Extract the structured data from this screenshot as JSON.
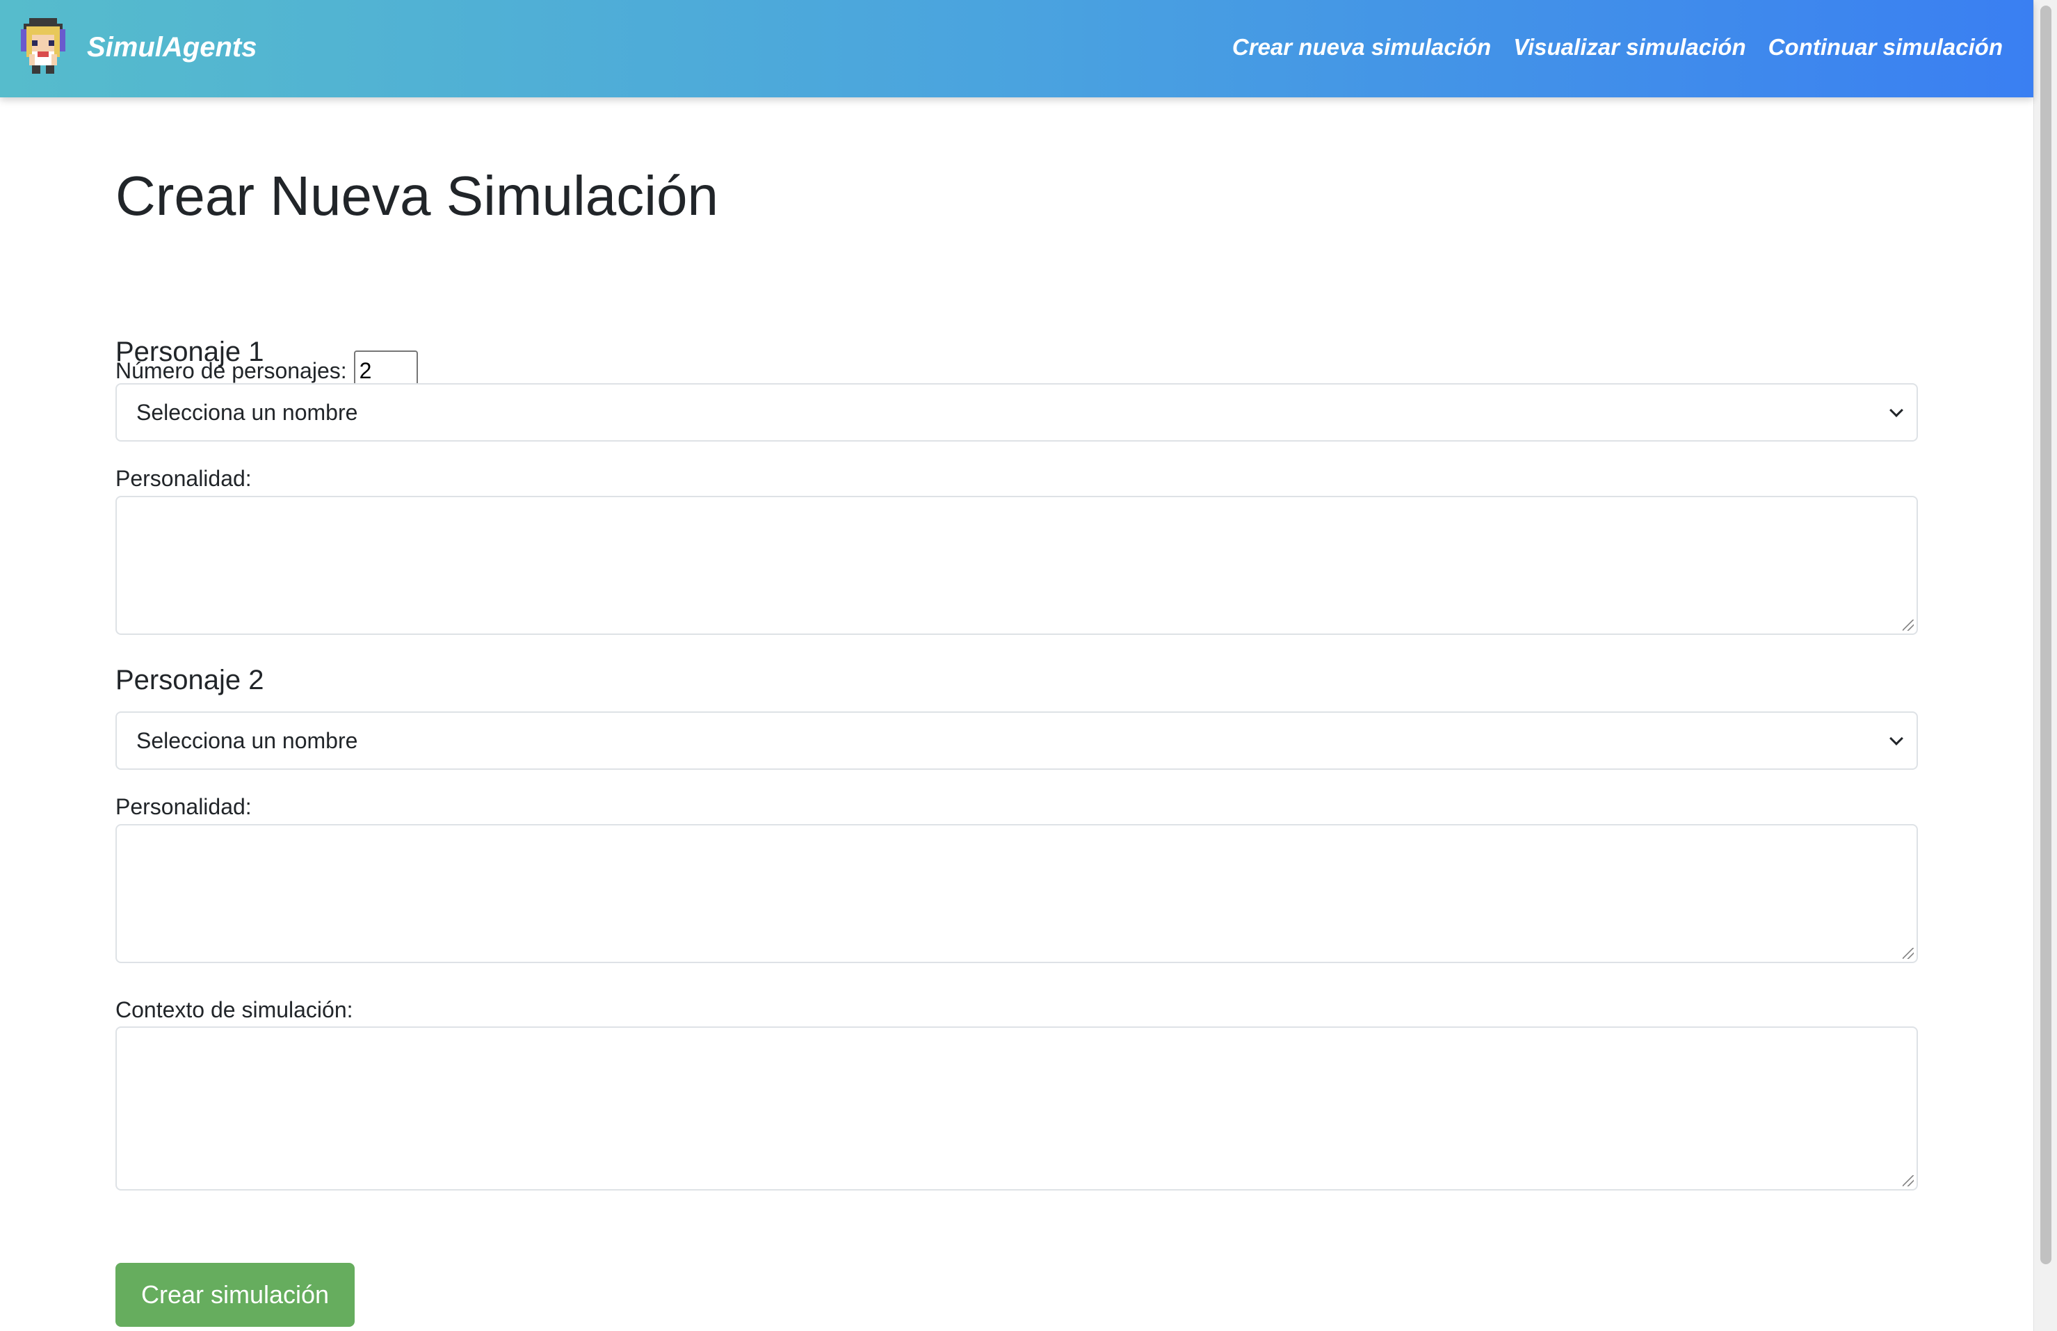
{
  "navbar": {
    "brand": "SimulAgents",
    "links": [
      "Crear nueva simulación",
      "Visualizar simulación",
      "Continuar simulación"
    ]
  },
  "main": {
    "title": "Crear Nueva Simulación",
    "count_label": "Número de personajes:",
    "count_value": "2",
    "characters": [
      {
        "heading": "Personaje 1",
        "select_value": "Selecciona un nombre",
        "personality_label": "Personalidad:"
      },
      {
        "heading": "Personaje 2",
        "select_value": "Selecciona un nombre",
        "personality_label": "Personalidad:"
      }
    ],
    "context_label": "Contexto de simulación:",
    "submit_label": "Crear simulación"
  },
  "icons": {
    "brand_logo": "pixel-character-avatar-icon",
    "select_chevron": "chevron-down-icon"
  },
  "colors": {
    "navbar_gradient_start": "#56bccc",
    "navbar_gradient_end": "#3a7ff2",
    "submit_button": "#66ad5e"
  }
}
